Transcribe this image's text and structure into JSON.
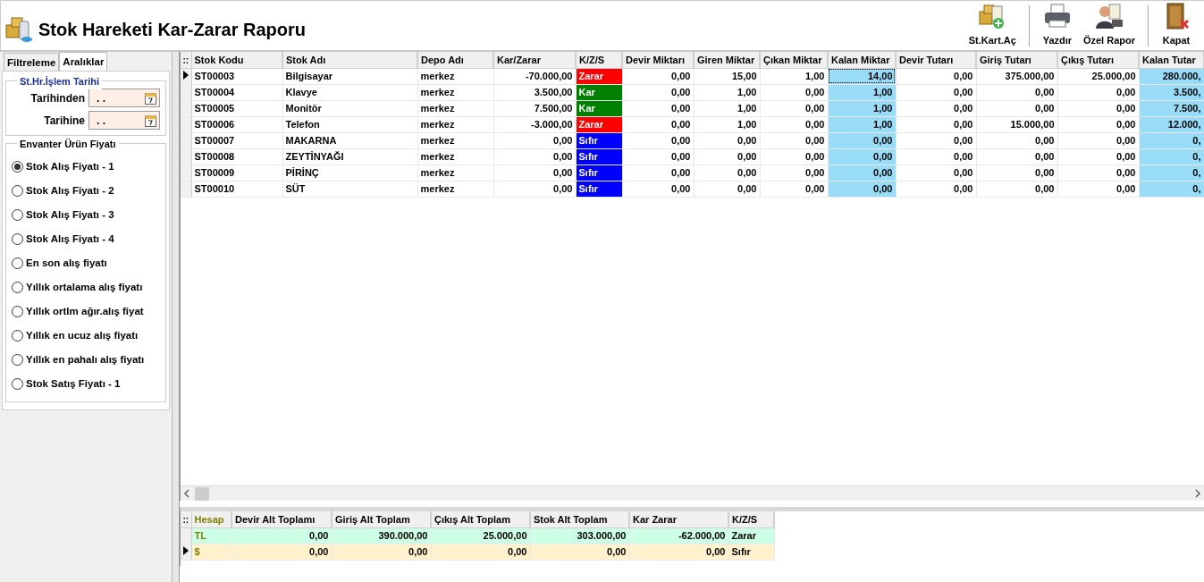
{
  "window": {
    "title": "Stok Hareketi Kar-Zarar Raporu"
  },
  "toolbar_groups": [
    {
      "buttons": [
        {
          "label": "St.Kart.Aç",
          "kind": "card"
        }
      ]
    },
    {
      "buttons": [
        {
          "label": "Yazdır",
          "kind": "print"
        },
        {
          "label": "Özel Rapor",
          "kind": "report"
        }
      ]
    },
    {
      "buttons": [
        {
          "label": "Kapat",
          "kind": "close"
        }
      ]
    }
  ],
  "filter_tabs": [
    {
      "label": "Filtreleme",
      "selected": false
    },
    {
      "label": "Aralıklar",
      "selected": true
    }
  ],
  "date_range": {
    "title": "St.Hr.İşlem Tarihi",
    "fields": [
      {
        "label": "Tarihinden",
        "value": ". ."
      },
      {
        "label": "Tarihine",
        "value": ". ."
      }
    ]
  },
  "price_group": {
    "title": "Envanter Ürün Fiyatı",
    "options": [
      {
        "label": "Stok Alış Fiyatı - 1",
        "selected": true
      },
      {
        "label": "Stok Alış Fiyatı - 2",
        "selected": false
      },
      {
        "label": "Stok Alış Fiyatı - 3",
        "selected": false
      },
      {
        "label": "Stok Alış Fiyatı - 4",
        "selected": false
      },
      {
        "label": "En son alış fiyatı",
        "selected": false
      },
      {
        "label": "Yıllık ortalama alış fiyatı",
        "selected": false
      },
      {
        "label": "Yıllık ortlm ağır.alış fiyat",
        "selected": false
      },
      {
        "label": "Yıllık en ucuz alış fiyatı",
        "selected": false
      },
      {
        "label": "Yıllık en pahalı alış fiyatı",
        "selected": false
      },
      {
        "label": "Stok Satış Fiyatı - 1",
        "selected": false
      }
    ]
  },
  "stock_grid": {
    "corner": "::",
    "columns": [
      {
        "label": "Stok Kodu",
        "kind": "text"
      },
      {
        "label": "Stok Adı",
        "kind": "text"
      },
      {
        "label": "Depo Adı",
        "kind": "text"
      },
      {
        "label": "Kar/Zarar",
        "kind": "number"
      },
      {
        "label": "K/Z/S",
        "kind": "status"
      },
      {
        "label": "Devir Miktarı",
        "kind": "number"
      },
      {
        "label": "Giren Miktar",
        "kind": "number"
      },
      {
        "label": "Çıkan Miktar",
        "kind": "number"
      },
      {
        "label": "Kalan Miktar",
        "kind": "balance"
      },
      {
        "label": "Devir Tutarı",
        "kind": "number"
      },
      {
        "label": "Giriş Tutarı",
        "kind": "number"
      },
      {
        "label": "Çıkış Tutarı",
        "kind": "number"
      },
      {
        "label": "Kalan Tutar",
        "kind": "balance"
      }
    ],
    "rows": [
      {
        "selected": true,
        "color": "#ff0000",
        "cells": [
          "ST00003",
          "Bilgisayar",
          "merkez",
          "-70.000,00",
          "Zarar",
          "0,00",
          "15,00",
          "1,00",
          "14,00",
          "0,00",
          "375.000,00",
          "25.000,00",
          "280.000,"
        ]
      },
      {
        "selected": false,
        "color": "#008000",
        "cells": [
          "ST00004",
          "Klavye",
          "merkez",
          "3.500,00",
          "Kar",
          "0,00",
          "1,00",
          "0,00",
          "1,00",
          "0,00",
          "0,00",
          "0,00",
          "3.500,"
        ]
      },
      {
        "selected": false,
        "color": "#008000",
        "cells": [
          "ST00005",
          "Monitör",
          "merkez",
          "7.500,00",
          "Kar",
          "0,00",
          "1,00",
          "0,00",
          "1,00",
          "0,00",
          "0,00",
          "0,00",
          "7.500,"
        ]
      },
      {
        "selected": false,
        "color": "#ff0000",
        "cells": [
          "ST00006",
          "Telefon",
          "merkez",
          "-3.000,00",
          "Zarar",
          "0,00",
          "1,00",
          "0,00",
          "1,00",
          "0,00",
          "15.000,00",
          "0,00",
          "12.000,"
        ]
      },
      {
        "selected": false,
        "color": "#0000ff",
        "cells": [
          "ST00007",
          "MAKARNA",
          "merkez",
          "0,00",
          "Sıfır",
          "0,00",
          "0,00",
          "0,00",
          "0,00",
          "0,00",
          "0,00",
          "0,00",
          "0,"
        ]
      },
      {
        "selected": false,
        "color": "#0000ff",
        "cells": [
          "ST00008",
          "ZEYTİNYAĞI",
          "merkez",
          "0,00",
          "Sıfır",
          "0,00",
          "0,00",
          "0,00",
          "0,00",
          "0,00",
          "0,00",
          "0,00",
          "0,"
        ]
      },
      {
        "selected": false,
        "color": "#0000ff",
        "cells": [
          "ST00009",
          "PİRİNÇ",
          "merkez",
          "0,00",
          "Sıfır",
          "0,00",
          "0,00",
          "0,00",
          "0,00",
          "0,00",
          "0,00",
          "0,00",
          "0,"
        ]
      },
      {
        "selected": false,
        "color": "#0000ff",
        "cells": [
          "ST00010",
          "SÜT",
          "merkez",
          "0,00",
          "Sıfır",
          "0,00",
          "0,00",
          "0,00",
          "0,00",
          "0,00",
          "0,00",
          "0,00",
          "0,"
        ]
      }
    ]
  },
  "summary_grid": {
    "corner": "::",
    "columns": [
      {
        "label": "Hesap",
        "kind": "account"
      },
      {
        "label": "Devir Alt Toplamı",
        "kind": "number"
      },
      {
        "label": "Giriş Alt Toplam",
        "kind": "number"
      },
      {
        "label": "Çıkış Alt Toplam",
        "kind": "number"
      },
      {
        "label": "Stok Alt Toplam",
        "kind": "number"
      },
      {
        "label": "Kar Zarar",
        "kind": "number"
      },
      {
        "label": "K/Z/S",
        "kind": "text"
      }
    ],
    "rows": [
      {
        "selected": false,
        "color": "#ccffe6",
        "cells": [
          "TL",
          "0,00",
          "390.000,00",
          "25.000,00",
          "303.000,00",
          "-62.000,00",
          "Zarar"
        ]
      },
      {
        "selected": true,
        "color": "#fff2cc",
        "cells": [
          "$",
          "0,00",
          "0,00",
          "0,00",
          "0,00",
          "0,00",
          "Sıfır"
        ]
      }
    ]
  }
}
